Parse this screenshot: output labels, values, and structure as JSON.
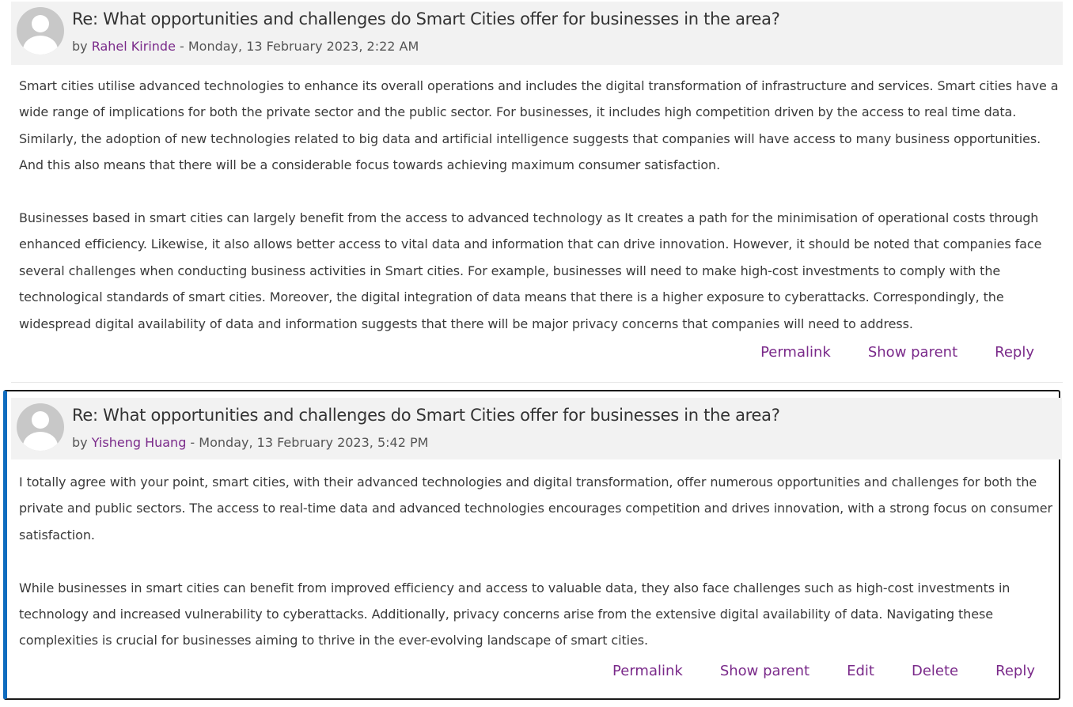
{
  "posts": [
    {
      "subject": "Re: What opportunities and challenges do Smart Cities offer for businesses in the area?",
      "by_prefix": "by ",
      "author": "Rahel Kirinde",
      "date_sep": " - ",
      "date": "Monday, 13 February 2023, 2:22 AM",
      "paragraphs": [
        "Smart cities utilise advanced technologies to enhance its overall operations and includes the digital transformation of infrastructure and services. Smart cities have a wide range of implications for both the private sector and the public sector. For businesses, it includes high competition driven by the access to real time data. Similarly, the adoption of new technologies related to big data and artificial intelligence suggests that companies will have access to many business opportunities. And this also means that there will be a considerable focus towards achieving maximum consumer satisfaction.",
        "Businesses based in smart cities can largely benefit from the access to advanced technology as It creates a path for the minimisation of operational costs through enhanced efficiency. Likewise, it also allows better access to vital data and information that can drive innovation. However, it should be noted that companies face several challenges when conducting business activities in Smart cities. For example, businesses will need to make high-cost investments to comply with the technological standards of smart cities. Moreover, the digital integration of data means that there is a higher exposure to cyberattacks. Correspondingly, the widespread digital availability of data and information suggests that there will be major privacy concerns that companies will need to address."
      ],
      "actions": [
        "Permalink",
        "Show parent",
        "Reply"
      ]
    },
    {
      "subject": "Re: What opportunities and challenges do Smart Cities offer for businesses in the area?",
      "by_prefix": "by ",
      "author": "Yisheng Huang",
      "date_sep": " - ",
      "date": "Monday, 13 February 2023, 5:42 PM",
      "paragraphs": [
        "I totally agree with your point, smart cities, with their advanced technologies and digital transformation, offer numerous opportunities and challenges for both the private and public sectors. The access to real-time data and advanced technologies encourages competition and drives innovation, with a strong focus on consumer satisfaction.",
        "While businesses in smart cities can benefit from improved efficiency and access to valuable data, they also face challenges such as high-cost investments in technology and increased vulnerability to cyberattacks. Additionally, privacy concerns arise from the extensive digital availability of data. Navigating these complexities is crucial for businesses aiming to thrive in the ever-evolving landscape of smart cities."
      ],
      "actions": [
        "Permalink",
        "Show parent",
        "Edit",
        "Delete",
        "Reply"
      ]
    }
  ],
  "colors": {
    "link": "#7a2a8a",
    "header_bg": "#f2f2f2",
    "focus_border_accent": "#0f6cbf"
  }
}
